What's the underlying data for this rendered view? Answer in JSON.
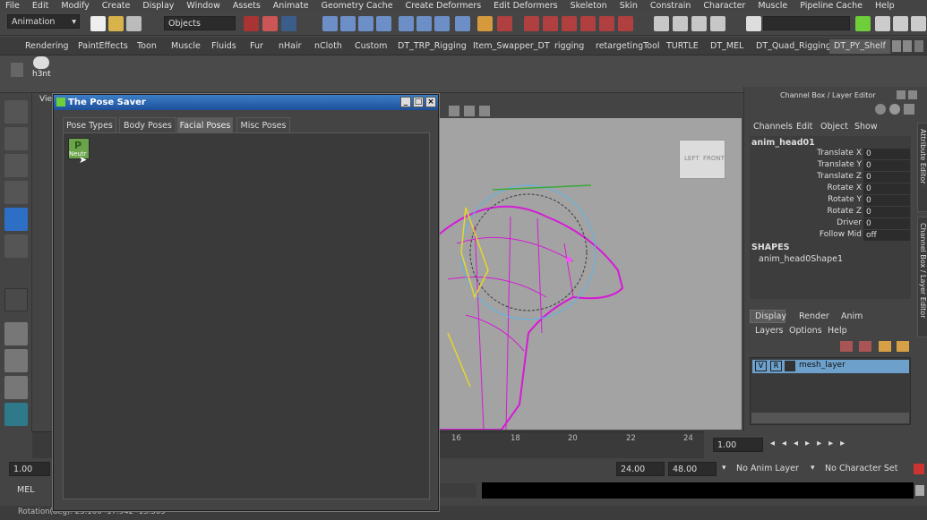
{
  "menubar": {
    "items": [
      "File",
      "Edit",
      "Modify",
      "Create",
      "Display",
      "Window",
      "Assets",
      "Animate",
      "Geometry Cache",
      "Create Deformers",
      "Edit Deformers",
      "Skeleton",
      "Skin",
      "Constrain",
      "Character",
      "Muscle",
      "Pipeline Cache",
      "Help"
    ]
  },
  "statusline": {
    "menuset": "Animation",
    "selection_mode": "Objects"
  },
  "shelf": {
    "tabs": [
      "Rendering",
      "PaintEffects",
      "Toon",
      "Muscle",
      "Fluids",
      "Fur",
      "nHair",
      "nCloth",
      "Custom",
      "DT_TRP_Rigging",
      "Item_Swapper_DT",
      "rigging",
      "retargetingTool",
      "TURTLE",
      "DT_MEL",
      "DT_Quad_Rigging",
      "DT_PY_Shelf"
    ],
    "active_tab": "DT_PY_Shelf",
    "item_label": "h3nt"
  },
  "viewport": {
    "menu_label": "View",
    "cube_left": "LEFT",
    "cube_front": "FRONT"
  },
  "timeline": {
    "ticks": [
      "16",
      "18",
      "20",
      "22",
      "24"
    ],
    "current_frame": "1.00"
  },
  "rangebar": {
    "start": "1.00",
    "end_display": "24.00",
    "end_total": "48.00",
    "anim_layer": "No Anim Layer",
    "char_set": "No Character Set"
  },
  "cmdline": {
    "label": "MEL"
  },
  "helpline": {
    "text": "Rotation(deg): 23.106 -17.942 -15.363"
  },
  "channelbox": {
    "title": "Channel Box / Layer Editor",
    "menus": [
      "Channels",
      "Edit",
      "Object",
      "Show"
    ],
    "object": "anim_head01",
    "attributes": [
      {
        "name": "Translate X",
        "value": "0"
      },
      {
        "name": "Translate Y",
        "value": "0"
      },
      {
        "name": "Translate Z",
        "value": "0"
      },
      {
        "name": "Rotate X",
        "value": "0"
      },
      {
        "name": "Rotate Y",
        "value": "0"
      },
      {
        "name": "Rotate Z",
        "value": "0"
      },
      {
        "name": "Driver",
        "value": "0"
      },
      {
        "name": "Follow Mid",
        "value": "off"
      }
    ],
    "shapes_header": "SHAPES",
    "shape": "anim_head0Shape1",
    "side_tabs": [
      "Attribute Editor",
      "Channel Box / Layer Editor"
    ]
  },
  "layereditor": {
    "tabs": [
      "Display",
      "Render",
      "Anim"
    ],
    "menus": [
      "Layers",
      "Options",
      "Help"
    ],
    "layer": {
      "v": "V",
      "r": "R",
      "name": "mesh_layer"
    }
  },
  "posesaver": {
    "title": "The Pose Saver",
    "tabs": [
      "Pose Types",
      "Body Poses",
      "Facial Poses",
      "Misc Poses"
    ],
    "active_tab": "Facial Poses",
    "item_label": "Neutr"
  },
  "colors": {
    "accent": "#6da0cb",
    "title_blue": "#2c6bb8",
    "mesh": "#d61ad6"
  }
}
